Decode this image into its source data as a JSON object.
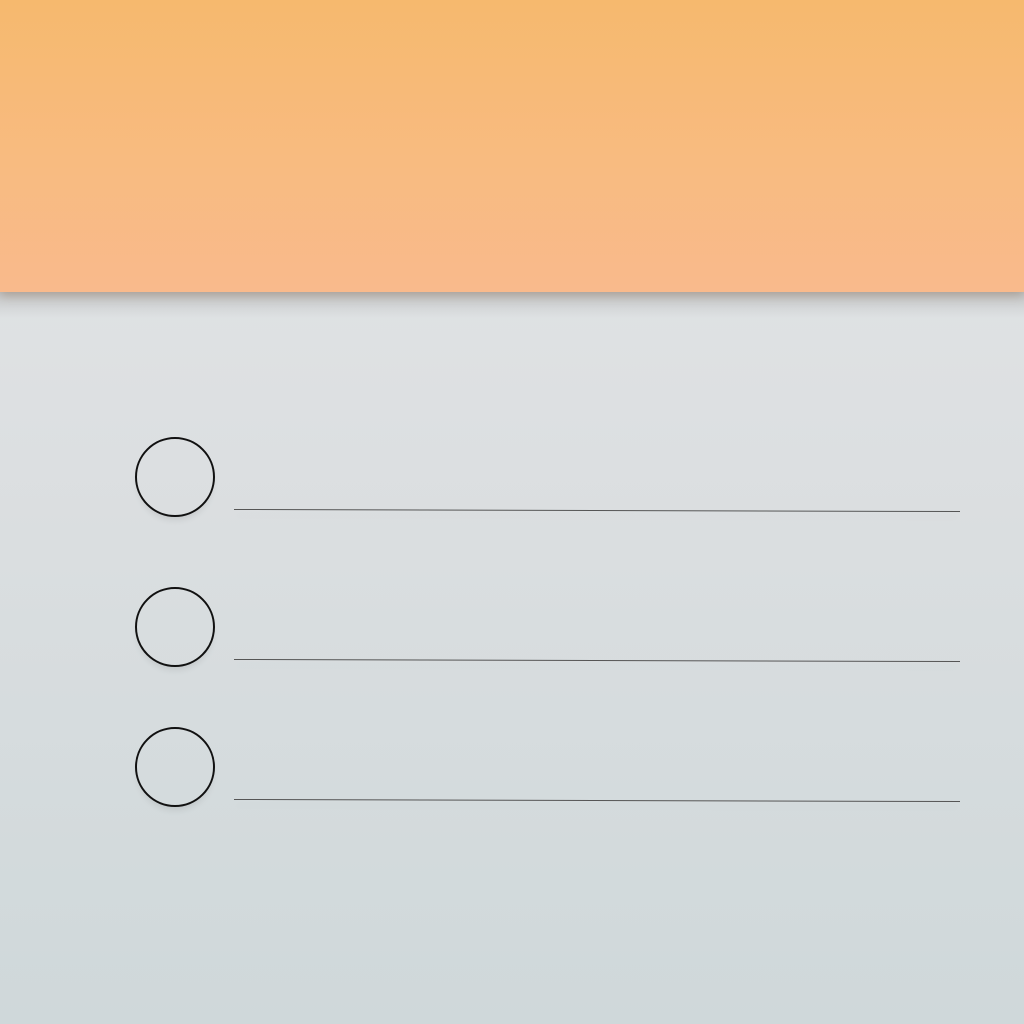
{
  "app": {
    "name": "",
    "colors": {
      "header_top": "#f6b96e",
      "header_bottom": "#f9ba8c",
      "background_top": "#e4e7e8",
      "background_bottom": "#cfd8da",
      "checkbox_stroke": "#111111",
      "line_stroke": "#555555"
    }
  },
  "checklist": {
    "items": [
      {
        "checked": false,
        "text": ""
      },
      {
        "checked": false,
        "text": ""
      },
      {
        "checked": false,
        "text": ""
      }
    ]
  }
}
